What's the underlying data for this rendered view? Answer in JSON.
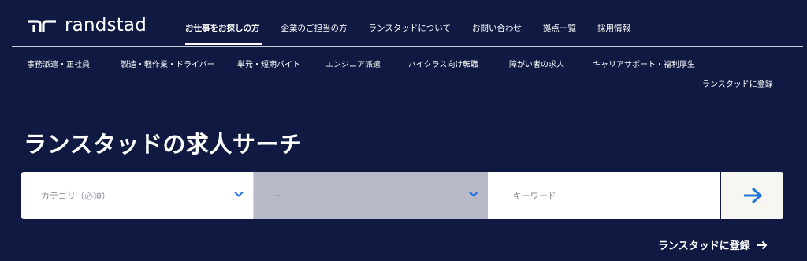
{
  "header": {
    "logo_text": "randstad",
    "main_nav": [
      {
        "label": "お仕事をお探しの方",
        "active": true
      },
      {
        "label": "企業のご担当の方",
        "active": false
      },
      {
        "label": "ランスタッドについて",
        "active": false
      },
      {
        "label": "お問い合わせ",
        "active": false
      },
      {
        "label": "拠点一覧",
        "active": false
      },
      {
        "label": "採用情報",
        "active": false
      }
    ]
  },
  "sub_nav": {
    "items": [
      {
        "label": "事務派遣・正社員"
      },
      {
        "label": "製造・軽作業・ドライバー"
      },
      {
        "label": "単発・短期バイト"
      },
      {
        "label": "エンジニア派遣"
      },
      {
        "label": "ハイクラス向け転職"
      },
      {
        "label": "障がい者の求人"
      },
      {
        "label": "キャリアサポート・福利厚生"
      }
    ],
    "register_label": "ランスタッドに登録"
  },
  "search": {
    "heading": "ランスタッドの求人サーチ",
    "category_placeholder": "カテゴリ（必須）",
    "subcategory_value": "ー",
    "keyword_placeholder": "キーワード",
    "submit_icon": "arrow-right-icon",
    "register_link": "ランスタッドに登録"
  },
  "colors": {
    "background": "#0f1941",
    "accent": "#2175d9",
    "disabled_field": "#b7b9c8",
    "submit_bg": "#f7f6f3"
  }
}
